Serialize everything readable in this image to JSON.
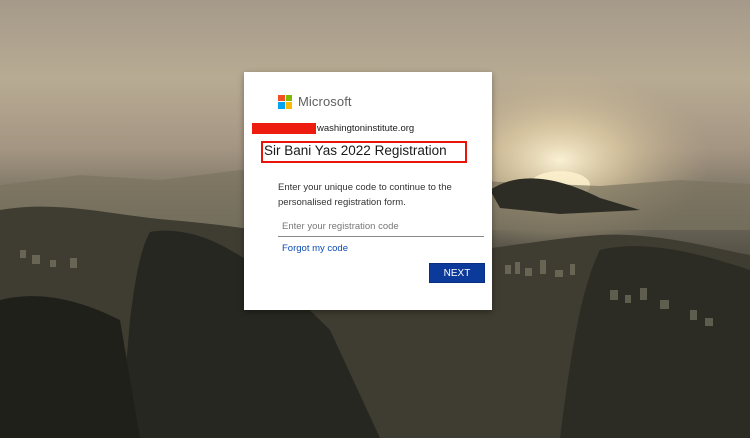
{
  "brand": {
    "name": "Microsoft",
    "logo_colors": [
      "#f25022",
      "#7fba00",
      "#00a4ef",
      "#ffb900"
    ]
  },
  "account": {
    "email_domain": "washingtoninstitute.org",
    "redaction_color": "#ee1c0e"
  },
  "form": {
    "title": "Sir Bani Yas 2022 Registration",
    "description": "Enter your unique code to continue to the personalised registration form.",
    "code_placeholder": "Enter your registration code",
    "code_value": "",
    "forgot_link": "Forgot my code",
    "next_label": "NEXT"
  },
  "colors": {
    "button": "#0c3a9a",
    "link": "#0a4bb4",
    "highlight_box": "#e8160a"
  }
}
